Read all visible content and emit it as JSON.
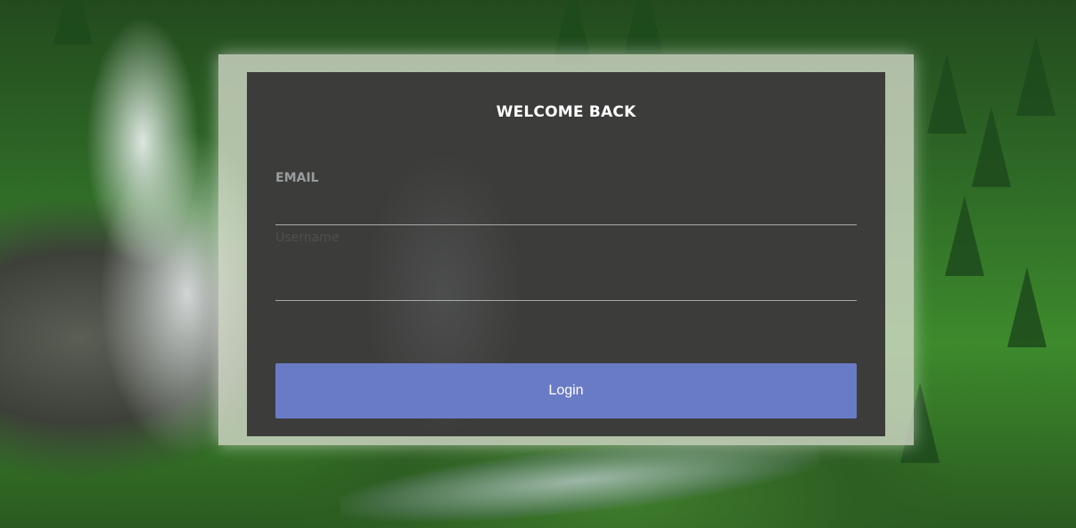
{
  "login": {
    "title": "WELCOME BACK",
    "email_label": "EMAIL",
    "email_value": "",
    "username_placeholder": "Username",
    "password_value": "",
    "button_label": "Login"
  },
  "colors": {
    "card_background": "#3c3d3b",
    "button_background": "#6a7bc6",
    "frosted_border": "#d7dccd"
  }
}
